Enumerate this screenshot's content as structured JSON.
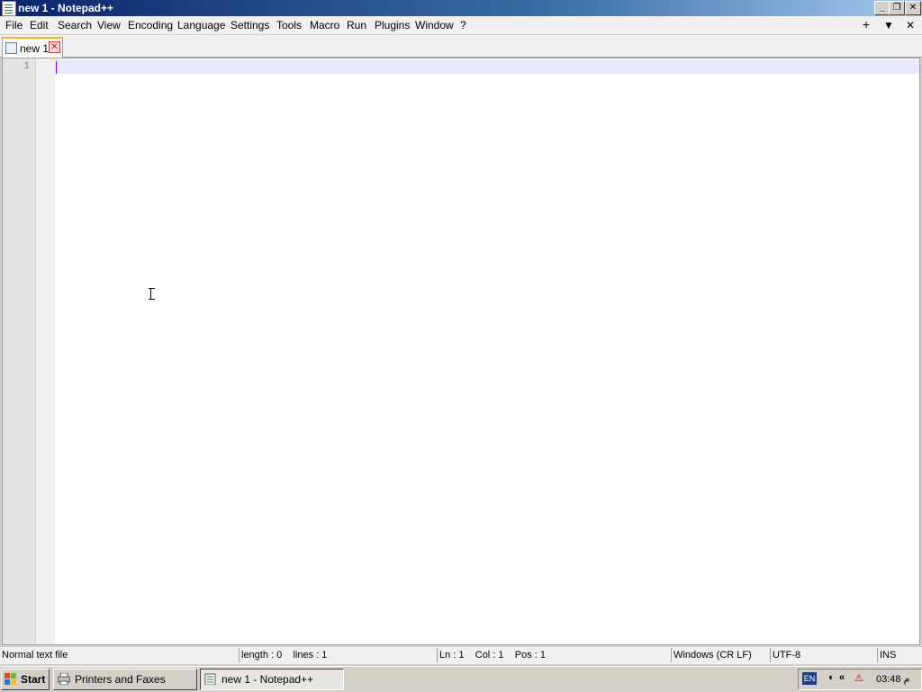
{
  "window": {
    "title": "new 1 - Notepad++",
    "controls": {
      "minimize": "_",
      "restore": "❐",
      "close": "✕"
    }
  },
  "menu": {
    "items": [
      "File",
      "Edit",
      "Search",
      "View",
      "Encoding",
      "Language",
      "Settings",
      "Tools",
      "Macro",
      "Run",
      "Plugins",
      "Window",
      "?"
    ],
    "right": {
      "new_tab": "+",
      "tab_list": "▼",
      "close": "✕"
    }
  },
  "tabs": [
    {
      "label": "new 1",
      "close": "✕",
      "active": true
    }
  ],
  "editor": {
    "line_numbers": [
      "1"
    ],
    "content": "",
    "current_line_color": "#e8e8ff",
    "caret_color": "#8000ff"
  },
  "statusbar": {
    "file_type": "Normal text file",
    "length_lines": "length : 0    lines : 1",
    "position": "Ln : 1    Col : 1    Pos : 1",
    "eol": "Windows (CR LF)",
    "encoding": "UTF-8",
    "mode": "INS"
  },
  "taskbar": {
    "start_label": "Start",
    "tasks": [
      {
        "label": "Printers and Faxes",
        "icon": "printer-icon",
        "active": false
      },
      {
        "label": "new 1 - Notepad++",
        "icon": "notepad-icon",
        "active": true
      }
    ],
    "tray": {
      "language": "EN",
      "icons": [
        "volume-icon",
        "chevron-left-icon",
        "network-alert-icon"
      ],
      "clock": "03:48 م"
    }
  },
  "colors": {
    "titlebar_start": "#0a246a",
    "titlebar_end": "#a6caf0",
    "tab_accent": "#fab131"
  }
}
